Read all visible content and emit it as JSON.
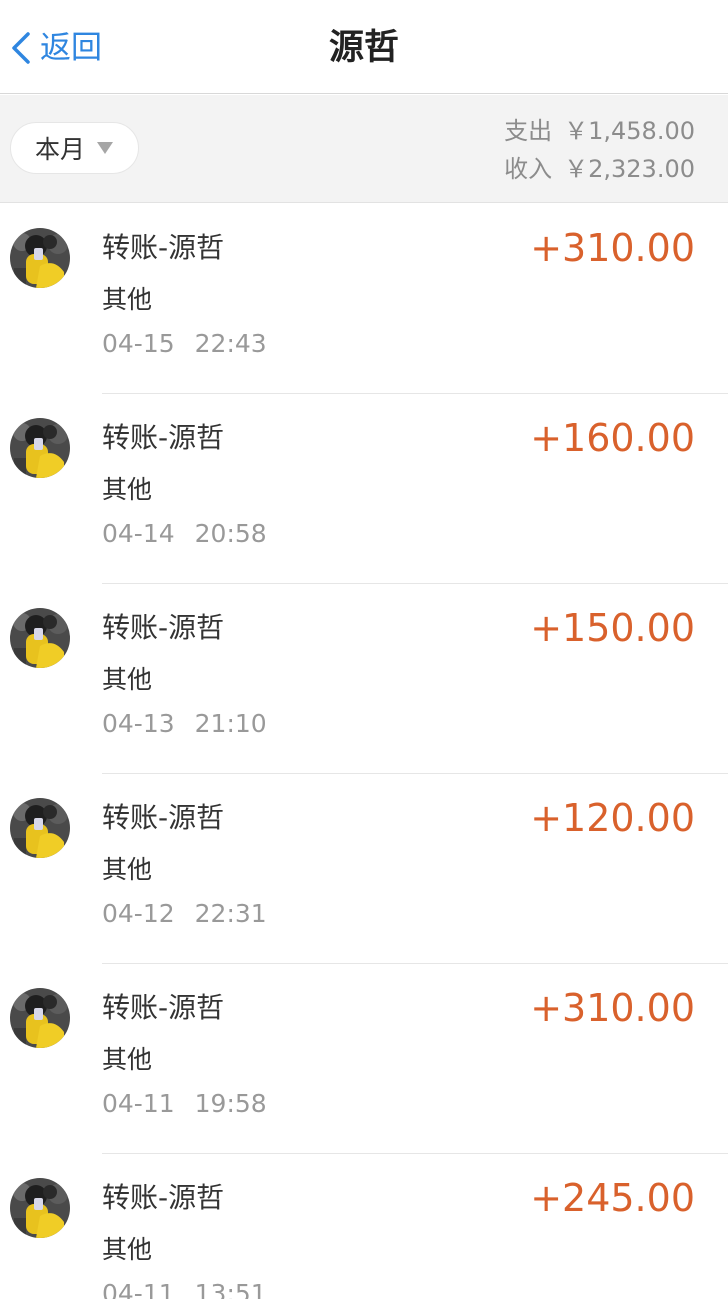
{
  "nav": {
    "back_label": "返回",
    "title": "源哲"
  },
  "filter": {
    "month_label": "本月"
  },
  "summary": {
    "expense_label": "支出",
    "expense_value": "￥1,458.00",
    "income_label": "收入",
    "income_value": "￥2,323.00"
  },
  "colors": {
    "accent": "#2f86e0",
    "income": "#d9612c"
  },
  "icons": {
    "back": "chevron-left-icon",
    "caret": "caret-down-icon",
    "avatar": "user-avatar"
  },
  "transactions": [
    {
      "title": "转账-源哲",
      "category": "其他",
      "date": "04-15",
      "time": "22:43",
      "amount": "+310.00"
    },
    {
      "title": "转账-源哲",
      "category": "其他",
      "date": "04-14",
      "time": "20:58",
      "amount": "+160.00"
    },
    {
      "title": "转账-源哲",
      "category": "其他",
      "date": "04-13",
      "time": "21:10",
      "amount": "+150.00"
    },
    {
      "title": "转账-源哲",
      "category": "其他",
      "date": "04-12",
      "time": "22:31",
      "amount": "+120.00"
    },
    {
      "title": "转账-源哲",
      "category": "其他",
      "date": "04-11",
      "time": "19:58",
      "amount": "+310.00"
    },
    {
      "title": "转账-源哲",
      "category": "其他",
      "date": "04-11",
      "time": "13:51",
      "amount": "+245.00"
    }
  ]
}
